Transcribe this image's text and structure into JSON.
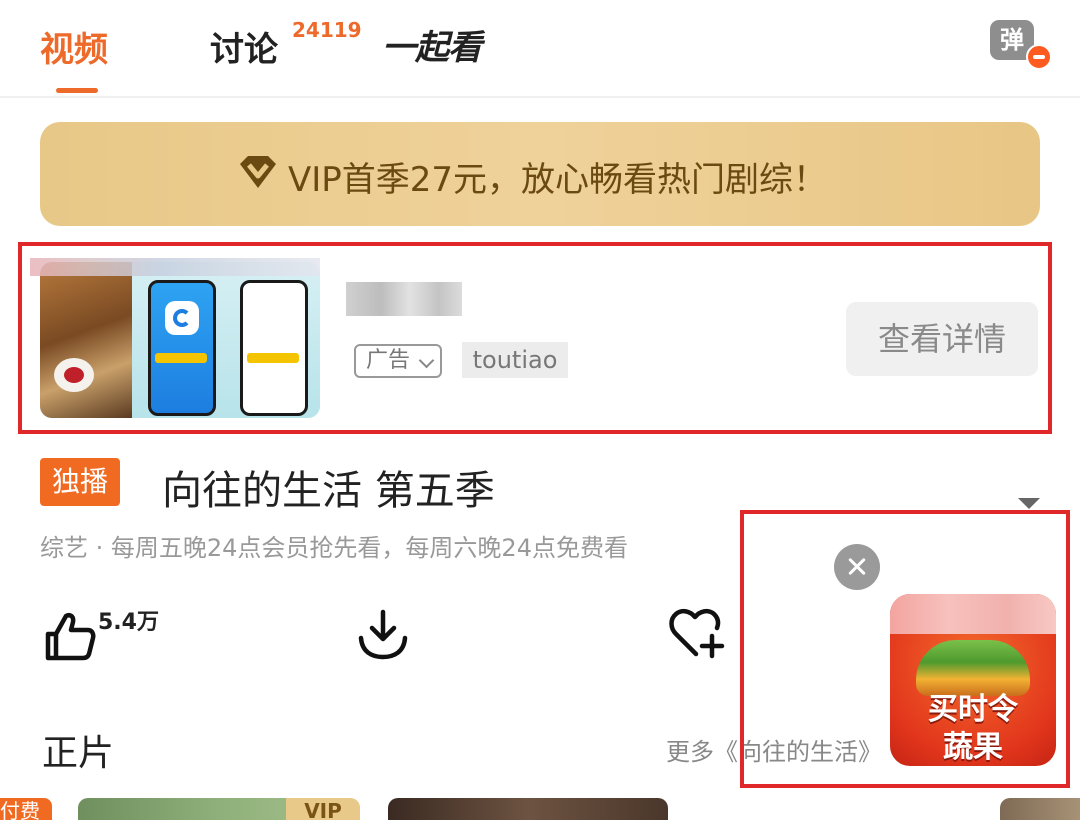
{
  "tabs": {
    "video": "视频",
    "discuss": "讨论",
    "discuss_count": "24119",
    "watch_together_prefix": "一起",
    "watch_together_2": "看",
    "danmu": "弹"
  },
  "vip_banner": {
    "text": "VIP首季27元，放心畅看热门剧综！"
  },
  "ad": {
    "badge": "广告",
    "source": "toutiao",
    "button": "查看详情"
  },
  "show": {
    "exclusive_tag": "独播",
    "title": "向往的生活 第五季",
    "meta": "综艺 · 每周五晚24点会员抢先看，每周六晚24点免费看",
    "likes": "5.4万"
  },
  "section": {
    "title": "正片",
    "more": "更多《向往的生活》"
  },
  "float_ad": {
    "line1": "买时令",
    "line2": "蔬果"
  },
  "bottom_row": {
    "tag": "付费",
    "vip": "VIP"
  },
  "colors": {
    "accent": "#ee6a2b",
    "highlight_border": "#e0282b",
    "vip_gold": "#e8c887"
  }
}
